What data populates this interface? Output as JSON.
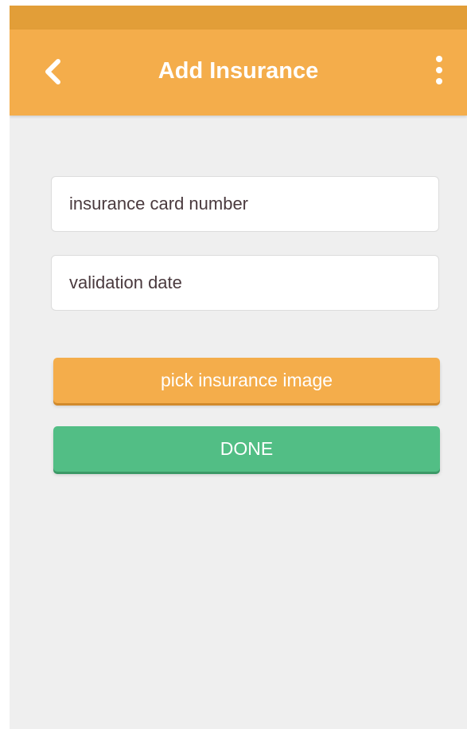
{
  "header": {
    "title": "Add Insurance",
    "back_icon": "chevron-left-icon",
    "menu_icon": "more-vertical-icon"
  },
  "form": {
    "card_number_placeholder": "insurance card number",
    "validation_date_placeholder": "validation date",
    "pick_image_label": "pick insurance image",
    "done_label": "DONE"
  },
  "colors": {
    "status_bar": "#e29e38",
    "app_bar": "#f4ad4b",
    "background": "#efefef",
    "pick_button": "#f4ad4b",
    "done_button": "#52be85",
    "field_text": "#4a3a3e"
  }
}
